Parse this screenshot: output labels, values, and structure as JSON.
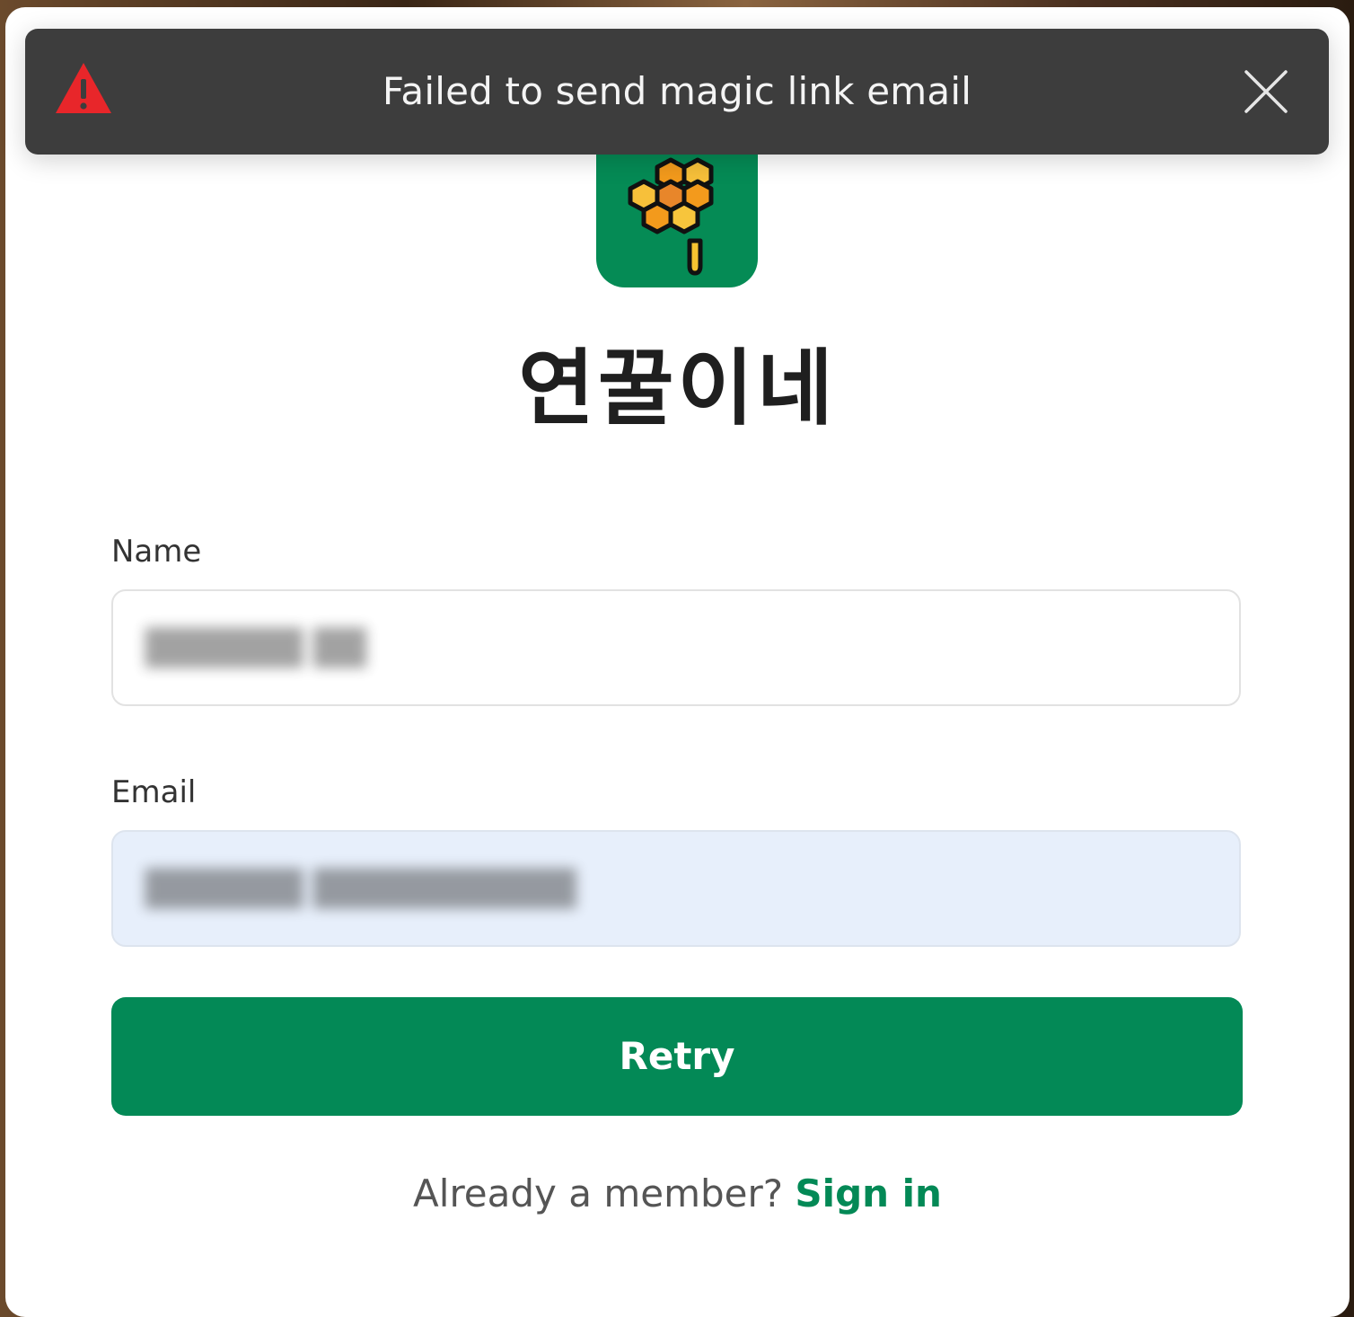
{
  "toast": {
    "message": "Failed to send magic link email",
    "icon": "warning-triangle-icon",
    "close_icon": "close-icon",
    "icon_color": "#e8262a"
  },
  "brand": {
    "title": "연꿀이네",
    "logo_icon": "honeycomb-logo-icon",
    "logo_bg_color": "#058b55"
  },
  "form": {
    "name_label": "Name",
    "email_label": "Email",
    "retry_label": "Retry"
  },
  "footer": {
    "prompt": "Already a member?",
    "link_label": "Sign in"
  },
  "colors": {
    "accent": "#038956",
    "toast_bg": "#3d3d3d"
  }
}
